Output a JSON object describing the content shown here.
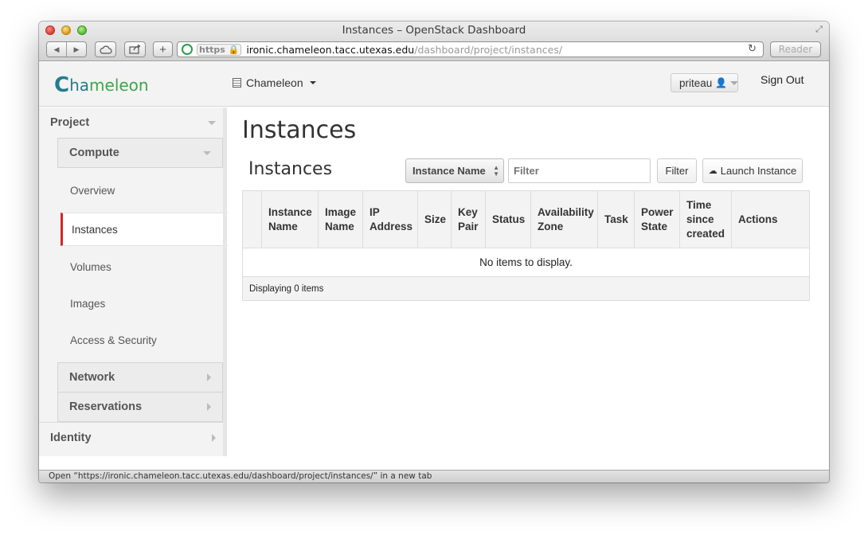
{
  "window": {
    "title": "Instances – OpenStack Dashboard"
  },
  "toolbar": {
    "back_icon": "back-arrow-icon",
    "forward_icon": "forward-arrow-icon",
    "https_label": "https",
    "url_host": "ironic.chameleon.tacc.utexas.edu",
    "url_path": "/dashboard/project/instances/",
    "reader_label": "Reader"
  },
  "header": {
    "logo_text": {
      "first": "C",
      "second": "ha",
      "third": "meleon"
    },
    "project_switcher": "Chameleon",
    "user": "priteau",
    "sign_out": "Sign Out"
  },
  "sidebar": {
    "project": "Project",
    "compute": "Compute",
    "items": [
      "Overview",
      "Instances",
      "Volumes",
      "Images",
      "Access & Security"
    ],
    "network": "Network",
    "reservations": "Reservations",
    "identity": "Identity"
  },
  "main": {
    "page_title": "Instances",
    "table_title": "Instances",
    "filter_field": "Instance Name",
    "filter_placeholder": "Filter",
    "filter_button": "Filter",
    "launch_button": "Launch Instance",
    "columns": [
      [
        "Instance",
        "Name"
      ],
      [
        "Image",
        "Name"
      ],
      [
        "IP",
        "Address"
      ],
      [
        "Size"
      ],
      [
        "Key",
        "Pair"
      ],
      [
        "Status"
      ],
      [
        "Availability",
        "Zone"
      ],
      [
        "Task"
      ],
      [
        "Power",
        "State"
      ],
      [
        "Time",
        "since",
        "created"
      ],
      [
        "Actions"
      ]
    ],
    "empty_message": "No items to display.",
    "footer": "Displaying 0 items"
  },
  "statusbar": {
    "text": "Open “https://ironic.chameleon.tacc.utexas.edu/dashboard/project/instances/” in a new tab"
  },
  "colors": {
    "active_marker": "#dd2222",
    "logo_teal": "#227d8f",
    "logo_green": "#3fa54a"
  }
}
